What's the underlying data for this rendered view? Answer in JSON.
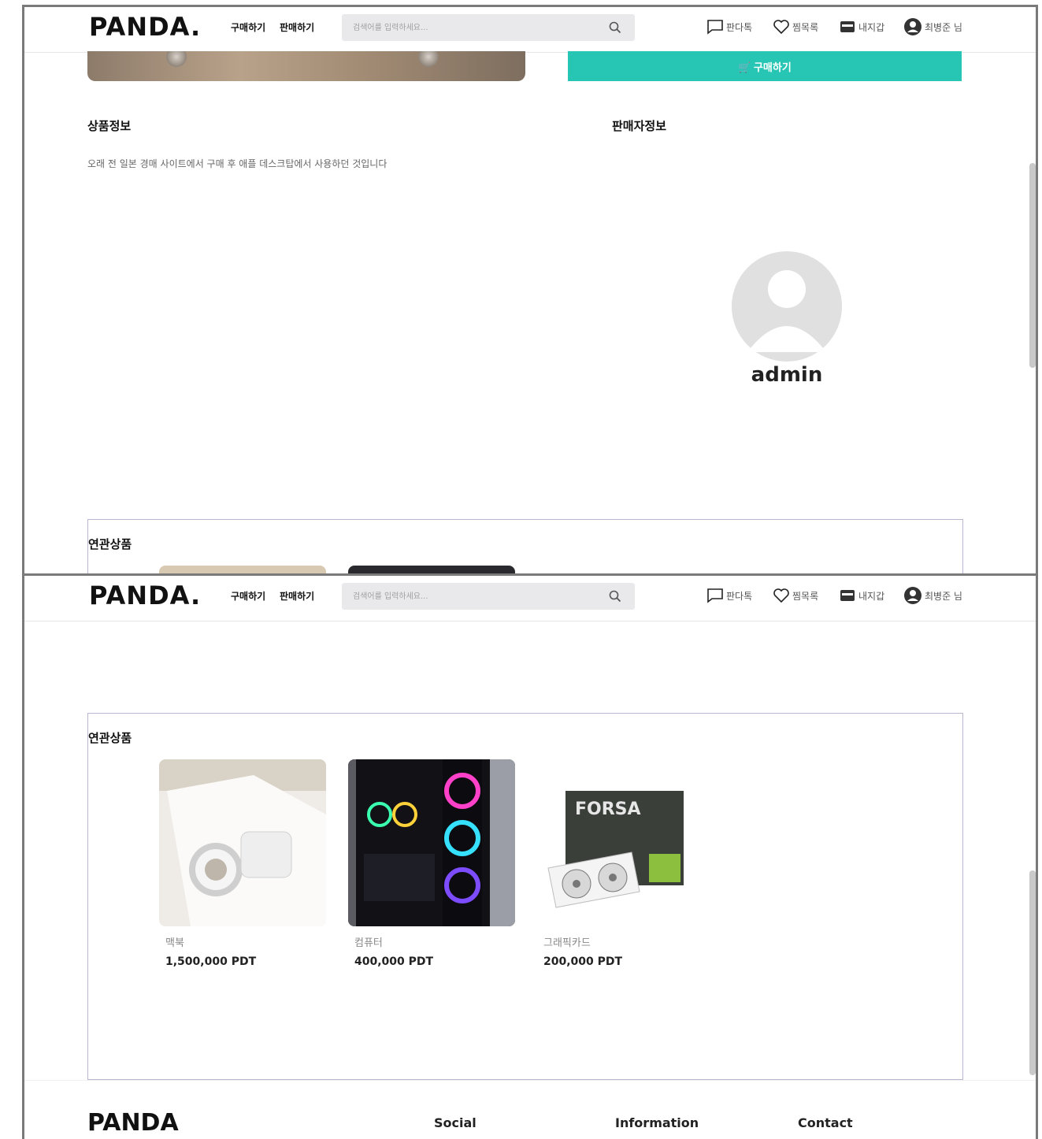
{
  "header": {
    "logo": "PANDA.",
    "nav": {
      "buy": "구매하기",
      "sell": "판매하기"
    },
    "search_placeholder": "검색어를 입력하세요...",
    "menu": {
      "panda_talk": "판다톡",
      "wishlist": "찜목록",
      "wallet": "내지갑",
      "user": "최병준 님"
    }
  },
  "product": {
    "buy_label": "🛒 구매하기",
    "info_title": "상품정보",
    "description": "오래 전 일본 경매 사이트에서 구매 후 애플 데스크탑에서 사용하던 것입니다",
    "seller_title": "판매자정보",
    "seller_name": "admin"
  },
  "related": {
    "title": "연관상품",
    "items": [
      {
        "name": "맥북",
        "price": "1,500,000 PDT"
      },
      {
        "name": "컴퓨터",
        "price": "400,000 PDT"
      },
      {
        "name": "그래픽카드",
        "price": "200,000 PDT"
      }
    ]
  },
  "footer": {
    "logo": "PANDA",
    "social": "Social",
    "information": "Information",
    "contact": "Contact"
  },
  "colors": {
    "accent": "#27c5b3",
    "search_bg": "#e9e9ec",
    "related_border": "#b8b6d0"
  }
}
